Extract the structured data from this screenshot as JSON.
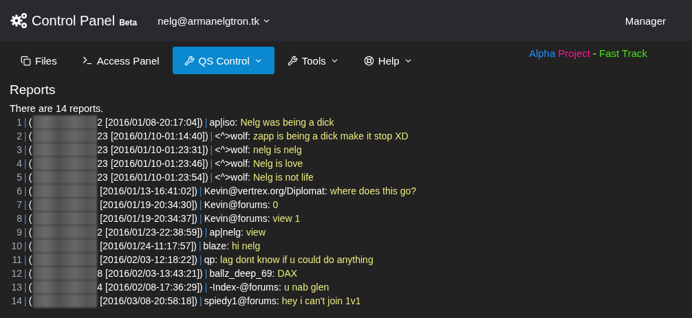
{
  "brand": {
    "title": "Control Panel",
    "badge": "Beta"
  },
  "account": {
    "label": "nelg@armanelgtron.tk"
  },
  "role": "Manager",
  "tabs": [
    {
      "label": "Files",
      "dropdown": false,
      "selected": false
    },
    {
      "label": "Access Panel",
      "dropdown": false,
      "selected": false
    },
    {
      "label": "QS Control",
      "dropdown": true,
      "selected": true
    },
    {
      "label": "Tools",
      "dropdown": true,
      "selected": false
    },
    {
      "label": "Help",
      "dropdown": true,
      "selected": false
    }
  ],
  "project": [
    {
      "text": "Alpha",
      "color": "#1e90ff"
    },
    {
      "text": "Project",
      "color": "#ff1493"
    },
    {
      "text": "-",
      "color": "#f0e68c"
    },
    {
      "text": "Fast Track",
      "color": "#4ce01e"
    }
  ],
  "heading": "Reports",
  "summary": "There are 14 reports.",
  "reports": [
    {
      "index": "1",
      "sep": "|",
      "open": "(",
      "ip_tail": "2",
      "time": "[2016/01/08-20:17:04])",
      "sep2": "|",
      "user": "ap|iso:",
      "message": "Nelg was being a dick"
    },
    {
      "index": "2",
      "sep": "|",
      "open": "(",
      "ip_tail": "23",
      "time": "[2016/01/10-01:14:40])",
      "sep2": "|",
      "user": "<^>wolf:",
      "message": "zapp is being a dick make it stop XD"
    },
    {
      "index": "3",
      "sep": "|",
      "open": "(",
      "ip_tail": "23",
      "time": "[2016/01/10-01:23:31])",
      "sep2": "|",
      "user": "<^>wolf:",
      "message": "nelg is nelg"
    },
    {
      "index": "4",
      "sep": "|",
      "open": "(",
      "ip_tail": "23",
      "time": "[2016/01/10-01:23:46])",
      "sep2": "|",
      "user": "<^>wolf:",
      "message": "Nelg is love"
    },
    {
      "index": "5",
      "sep": "|",
      "open": "(",
      "ip_tail": "23",
      "time": "[2016/01/10-01:23:54])",
      "sep2": "|",
      "user": "<^>wolf:",
      "message": "Nelg is not life"
    },
    {
      "index": "6",
      "sep": "|",
      "open": "(",
      "time": "[2016/01/13-16:41:02])",
      "sep2": "|",
      "user": "Kevin@vertrex.org/Diplomat:",
      "message": "where does this go?"
    },
    {
      "index": "7",
      "sep": "|",
      "open": "(",
      "time": "[2016/01/19-20:34:30])",
      "sep2": "|",
      "user": "Kevin@forums:",
      "message": "0"
    },
    {
      "index": "8",
      "sep": "|",
      "open": "(",
      "time": "[2016/01/19-20:34:37])",
      "sep2": "|",
      "user": "Kevin@forums:",
      "message": "view 1"
    },
    {
      "index": "9",
      "sep": "|",
      "open": "(",
      "ip_tail": "2",
      "time": "[2016/01/23-22:38:59])",
      "sep2": "|",
      "user": "ap|nelg:",
      "message": "view"
    },
    {
      "index": "10",
      "sep": "|",
      "open": "(",
      "time": "[2016/01/24-11:17:57])",
      "sep2": "|",
      "user": "blaze:",
      "message": "hi nelg"
    },
    {
      "index": "11",
      "sep": "|",
      "open": "(",
      "time": "[2016/02/03-12:18:22])",
      "sep2": "|",
      "user": "qp:",
      "message": "lag dont know if u could do anything"
    },
    {
      "index": "12",
      "sep": "|",
      "open": "(",
      "ip_tail": "8",
      "time": "[2016/02/03-13:43:21])",
      "sep2": "|",
      "user": "ballz_deep_69:",
      "message": "DAX"
    },
    {
      "index": "13",
      "sep": "|",
      "open": "(",
      "ip_tail": "4",
      "time": "[2016/02/08-17:36:29])",
      "sep2": "|",
      "user": "-Index-@forums:",
      "message": "u nab glen"
    },
    {
      "index": "14",
      "sep": "|",
      "open": "(",
      "time": "[2016/03/08-20:58:18])",
      "sep2": "|",
      "user": "spiedy1@forums:",
      "message": "hey i can't join 1v1"
    }
  ]
}
